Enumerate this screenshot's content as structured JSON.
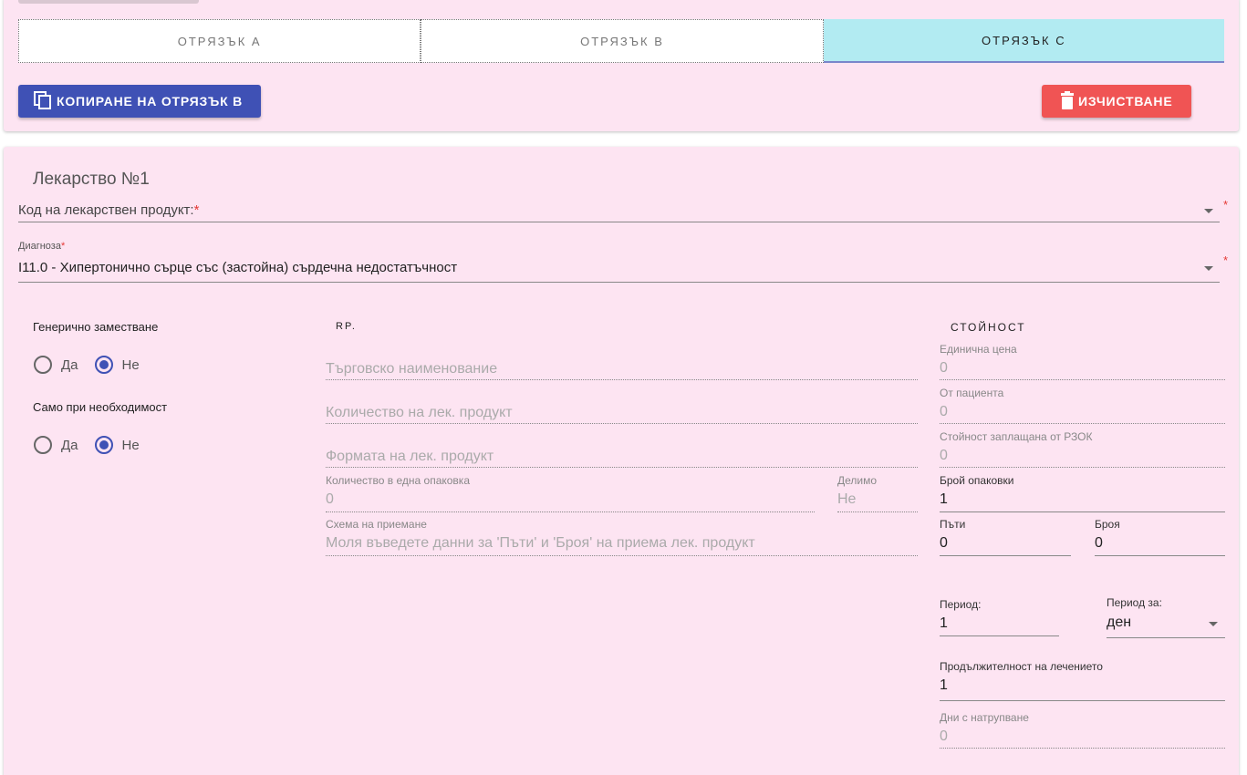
{
  "tabs": [
    {
      "label": "ОТРЯЗЪК А"
    },
    {
      "label": "ОТРЯЗЪК В"
    },
    {
      "label": "ОТРЯЗЪК С"
    }
  ],
  "buttons": {
    "copy_label": "КОПИРАНЕ НА ОТРЯЗЪК В",
    "clear_label": "ИЗЧИСТВАНЕ"
  },
  "medicine": {
    "title": "Лекарство №1",
    "product_code": {
      "label": "Код на лекарствен продукт:",
      "required_mark": "*",
      "value": ""
    },
    "diagnosis": {
      "label": "Диагноза",
      "required_mark": "*",
      "value": "I11.0 - Хипертонично сърце със (застойна) сърдечна недостатъчност"
    },
    "generic_substitution": {
      "label": "Генерично заместване",
      "options": [
        "Да",
        "Не"
      ],
      "selected": "Не"
    },
    "only_if_needed": {
      "label": "Само при необходимост",
      "options": [
        "Да",
        "Не"
      ],
      "selected": "Не"
    }
  },
  "rp": {
    "heading": "RP.",
    "trade_name_placeholder": "Търговско наименование",
    "quantity_placeholder": "Количество на лек. продукт",
    "form_placeholder": "Формата на лек. продукт",
    "qty_per_pack": {
      "label": "Количество в една опаковка",
      "value": "0"
    },
    "divisible": {
      "label": "Делимо",
      "value": "Не"
    },
    "dosage_scheme": {
      "label": "Схема на приемане",
      "value": "Моля въведете данни за 'Пъти' и 'Броя' на приема лек. продукт"
    }
  },
  "cost": {
    "heading": "СТОЙНОСТ",
    "unit_price": {
      "label": "Единична цена",
      "value": "0"
    },
    "from_patient": {
      "label": "От пациента",
      "value": "0"
    },
    "rzok_paid": {
      "label": "Стойност заплащана от РЗОК",
      "value": "0"
    },
    "packages": {
      "label": "Брой опаковки",
      "value": "1"
    },
    "times": {
      "label": "Пъти",
      "value": "0"
    },
    "count": {
      "label": "Броя",
      "value": "0"
    },
    "period": {
      "label": "Период:",
      "value": "1"
    },
    "period_for": {
      "label": "Период за:",
      "value": "ден"
    },
    "treatment_duration": {
      "label": "Продължителност на лечението",
      "value": "1"
    },
    "accumulation_days": {
      "label": "Дни с натрупване",
      "value": "0"
    }
  },
  "colors": {
    "card_bg": "#fde4f2",
    "primary": "#3f51b5",
    "danger": "#f05454",
    "active_tab": "#b2ebf2"
  },
  "icons": {
    "copy": "copy-icon",
    "delete": "trash-icon"
  }
}
